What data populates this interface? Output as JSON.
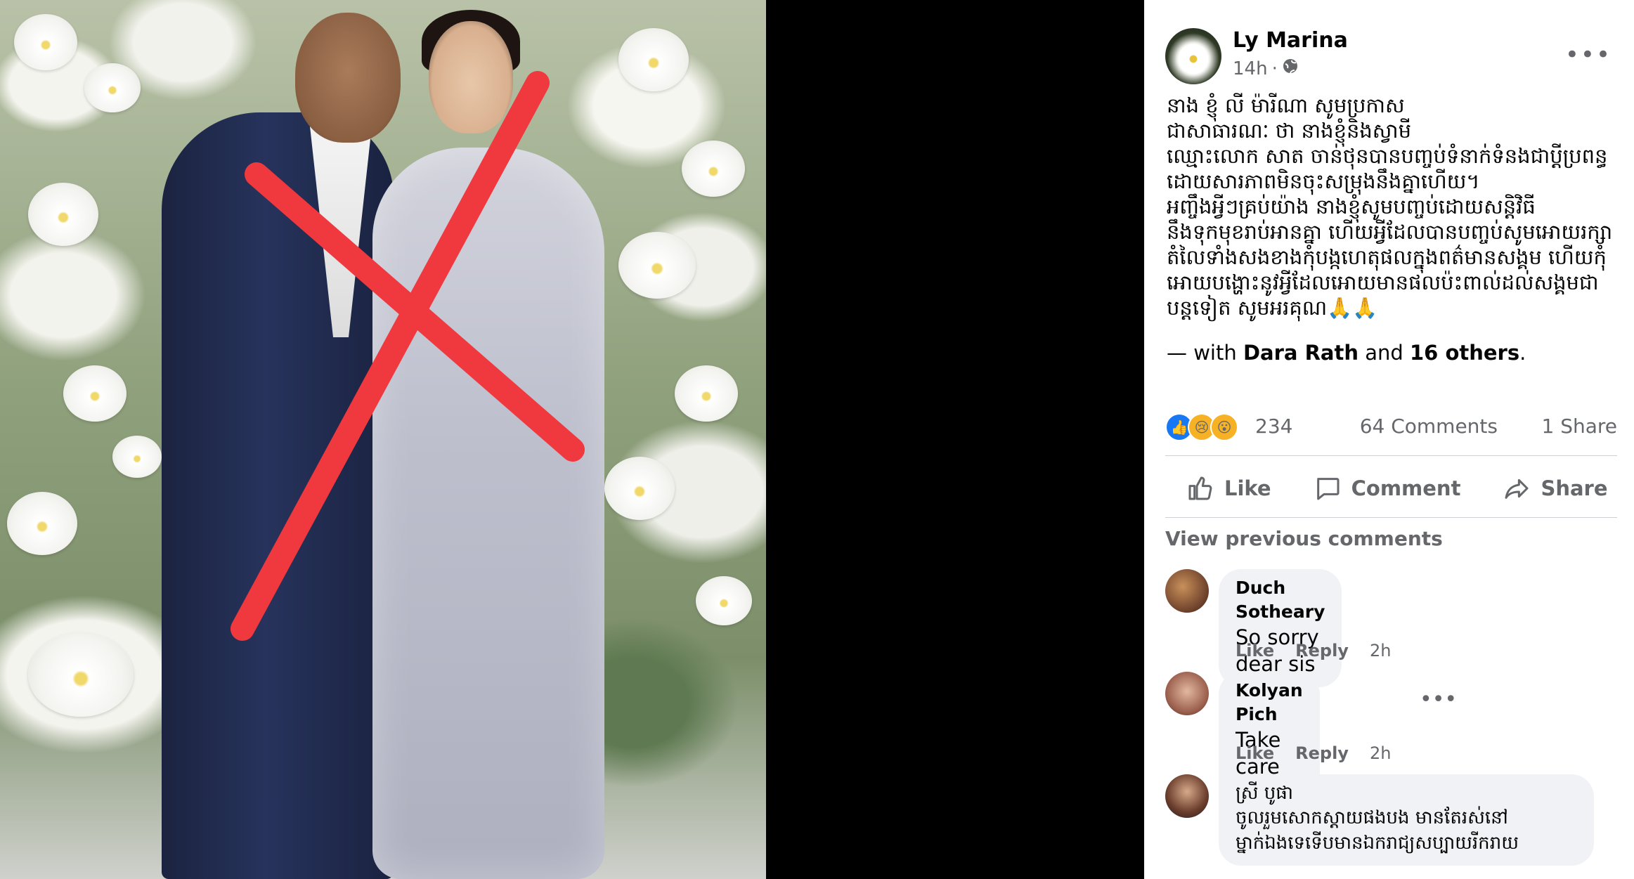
{
  "post": {
    "author": "Ly Marina",
    "time": "14h",
    "visibility_icon": "globe-icon",
    "text": "នាង ខ្ញុំ លី ម៉ារីណា សូមប្រកាស\nជាសាធារណៈ ថា នាងខ្ញុំនិងស្វាមី\nឈ្មោះលោក សាត ចាន់ថុនបានបញ្ចប់ទំនាក់ទំនងជាប្ដីប្រពន្ធ\nដោយសារភាពមិនចុះសម្រុងនឹងគ្នាហើយ។\nអញ្ចឹងអ្វីៗគ្រប់យ៉ាង នាងខ្ញុំសូមបញ្ចប់ដោយសន្តិវិធី\nនឹងទុកមុខរាប់អានគ្នា ហើយអ្វីដែលបានបញ្ចប់សូមអោយរក្សា\nតំលៃទាំងសងខាងកុំបង្កហេតុផលក្នុងពត៌មានសង្គម ហើយកុំ\nអោយបង្ហោះនូវអ្វីដែលអោយមានផលប៉ះពាល់ដល់សង្គមជា\nបន្តទៀត សូមអរគុណ🙏🙏",
    "tag_prefix": "— with",
    "tag_name": "Dara Rath",
    "tag_and": "and",
    "tag_others": "16 others",
    "tag_suffix": "."
  },
  "stats": {
    "reactions_count": "234",
    "comments": "64 Comments",
    "shares": "1 Share",
    "reaction_icons": [
      "like-reaction-icon",
      "sad-reaction-icon",
      "wow-reaction-icon"
    ]
  },
  "actions": {
    "like": "Like",
    "comment": "Comment",
    "share": "Share"
  },
  "comments_section": {
    "view_previous": "View previous comments",
    "items": [
      {
        "name": "Duch Sotheary",
        "text": "So sorry dear sis",
        "like": "Like",
        "reply": "Reply",
        "time": "2h"
      },
      {
        "name": "Kolyan Pich",
        "text": "Take care sis 💗",
        "like": "Like",
        "reply": "Reply",
        "time": "2h"
      },
      {
        "name": "ស្រី បូផា",
        "text": "ចូលរួមសោកស្តាយផងបង មានតែរស់នៅ\nម្នាក់ឯងទេទើបមានឯករាជ្យសប្បាយរីករាយ",
        "like": "",
        "reply": "",
        "time": ""
      }
    ]
  },
  "colors": {
    "cross": "#f0393e",
    "like_blue": "#1877f2",
    "muted_text": "#65676b",
    "bubble_bg": "#f0f2f5"
  }
}
